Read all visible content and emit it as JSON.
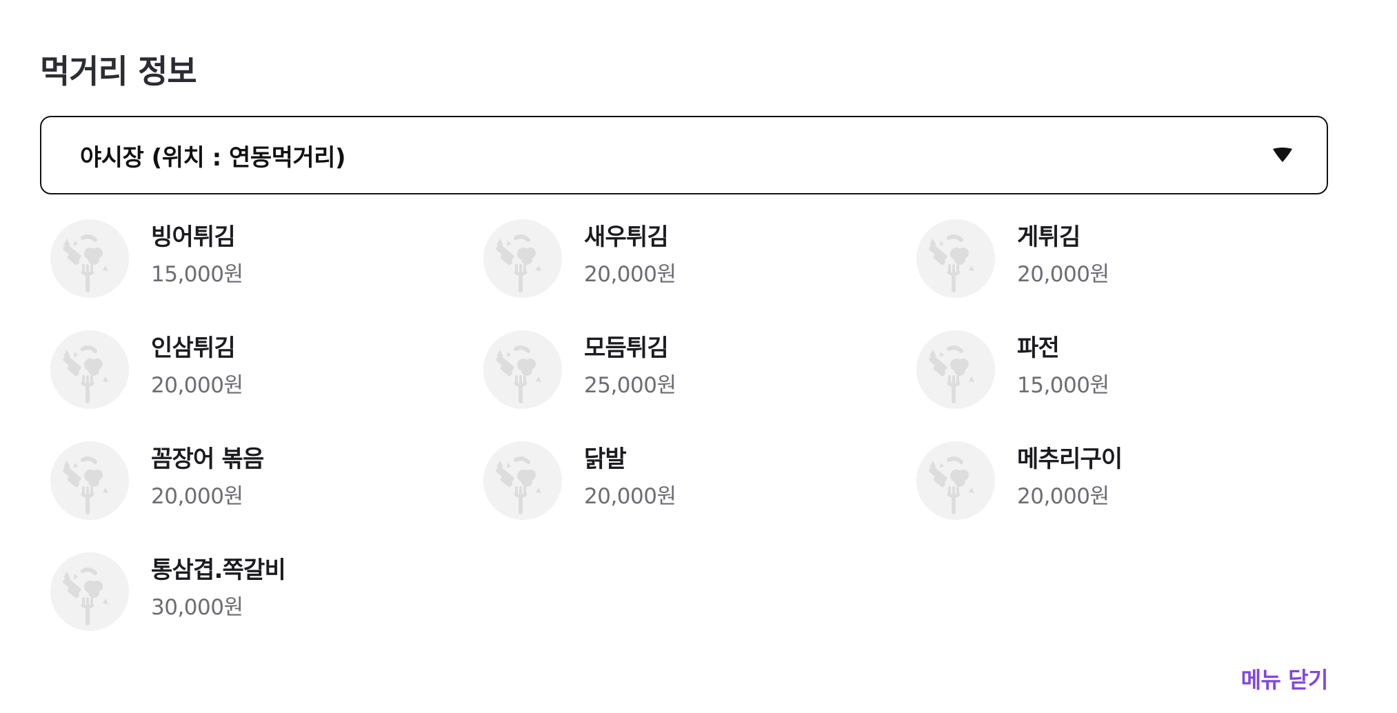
{
  "section": {
    "title": "먹거리 정보"
  },
  "selector": {
    "label": "야시장 (위치 : 연동먹거리)",
    "icon": "caret-down-icon"
  },
  "menu_items": [
    {
      "name": "빙어튀김",
      "price": "15,000원",
      "icon": "food-placeholder-icon"
    },
    {
      "name": "새우튀김",
      "price": "20,000원",
      "icon": "food-placeholder-icon"
    },
    {
      "name": "게튀김",
      "price": "20,000원",
      "icon": "food-placeholder-icon"
    },
    {
      "name": "인삼튀김",
      "price": "20,000원",
      "icon": "food-placeholder-icon"
    },
    {
      "name": "모듬튀김",
      "price": "25,000원",
      "icon": "food-placeholder-icon"
    },
    {
      "name": "파전",
      "price": "15,000원",
      "icon": "food-placeholder-icon"
    },
    {
      "name": "꼼장어 볶음",
      "price": "20,000원",
      "icon": "food-placeholder-icon"
    },
    {
      "name": "닭발",
      "price": "20,000원",
      "icon": "food-placeholder-icon"
    },
    {
      "name": "메추리구이",
      "price": "20,000원",
      "icon": "food-placeholder-icon"
    },
    {
      "name": "통삼겹.쪽갈비",
      "price": "30,000원",
      "icon": "food-placeholder-icon"
    }
  ],
  "footer": {
    "close_label": "메뉴 닫기"
  },
  "colors": {
    "accent": "#7f45e8",
    "thumbnail_bg": "#f2f2f2",
    "price_text": "#6c6c74"
  }
}
